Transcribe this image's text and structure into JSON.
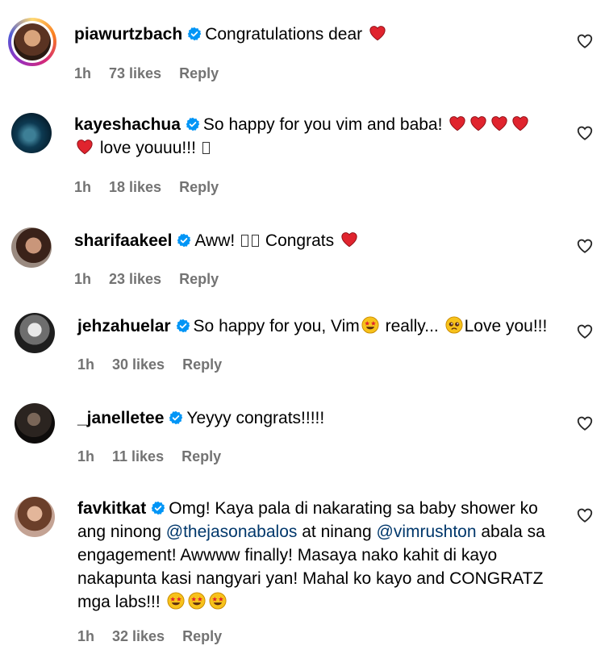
{
  "colors": {
    "text": "#000000",
    "meta": "#737373",
    "mention": "#00376b",
    "verified": "#0095f6",
    "heart": "#e0242e"
  },
  "comments": [
    {
      "username": "piawurtzbach",
      "pre": "Congratulations dear",
      "time": "1h",
      "likes": "73 likes",
      "reply": "Reply"
    },
    {
      "username": "kayeshachua",
      "pre": "So happy for you vim and baba!",
      "line2": "love youuu!!!",
      "time": "1h",
      "likes": "18 likes",
      "reply": "Reply"
    },
    {
      "username": "sharifaakeel",
      "pre": "Aww!",
      "post": "Congrats",
      "time": "1h",
      "likes": "23 likes",
      "reply": "Reply"
    },
    {
      "username": "jehzahuelar",
      "pre": "So happy for you, Vim",
      "mid": "really...",
      "post": "Love you!!!",
      "time": "1h",
      "likes": "30 likes",
      "reply": "Reply"
    },
    {
      "username": "_janelletee",
      "pre": "Yeyyy congrats!!!!!",
      "time": "1h",
      "likes": "11 likes",
      "reply": "Reply"
    },
    {
      "username": "favkitkat",
      "pre": "Omg! Kaya pala di nakarating sa baby shower ko",
      "l2a": "ang ninong",
      "mention1": "@thejasonabalos",
      "l2b": "at ninang",
      "mention2": "@vimrushton",
      "l2c": "abala sa",
      "l3": "engagement! Awwww finally! Masaya nako kahit di kayo",
      "l4": "nakapunta kasi nangyari yan! Mahal ko kayo and CONGRATZ",
      "l5": "mga labs!!!",
      "time": "1h",
      "likes": "32 likes",
      "reply": "Reply"
    }
  ]
}
